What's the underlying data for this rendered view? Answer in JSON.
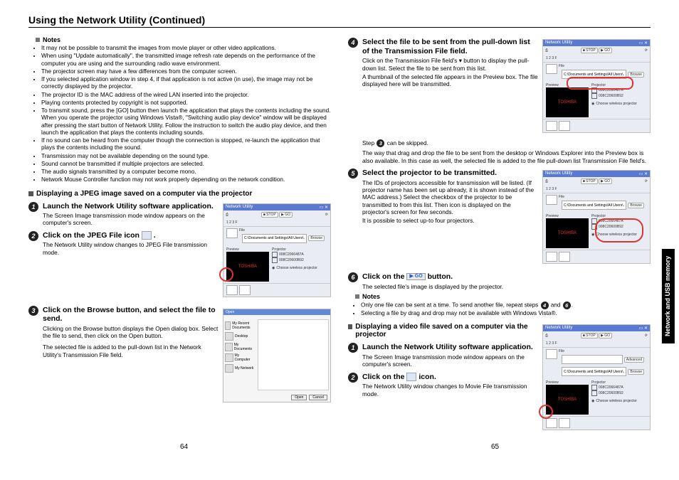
{
  "title": "Using the Network Utility (Continued)",
  "sideTab": "Network and USB memory",
  "pageLeft": "64",
  "pageRight": "65",
  "notesLabel": "Notes",
  "notes1": [
    "It may not be possible to transmit the images from movie player or other video applications.",
    "When using \"Update automatically\", the transmitted image refresh rate depends on the performance of the computer you are using and the surrounding radio wave environment.",
    "The projector screen may have a few differences from the computer screen.",
    "If you selected application window in step 4, if that application is not active (in use), the image may not be correctly displayed by the projector.",
    "The projector ID is the MAC address of the wired LAN inserted into the projector.",
    "Playing contents protected by copyright is not supported.",
    "To transmit sound, press the [GO] button then launch the application that plays the contents including the sound. When you operate the projector using Windows Vista®, \"Switching audio play device\" window will be displayed after pressing the start button of Network Utility. Follow the instruction to switch the audio play device, and then launch the application that plays the contents including sounds.",
    "If no sound can be heard from the computer though the connection is stopped, re-launch the application that plays the contents including the sound.",
    "Transmission may not be available depending on the sound type.",
    "Sound cannot be transmitted if multiple projectors are selected.",
    "The audio signals transmitted by a computer become mono.",
    "Network Mouse Controller function may not work properly depending on the network condition."
  ],
  "sectionJpeg": "Displaying a JPEG image saved on a computer via the projector",
  "step1": {
    "head": "Launch the Network Utility software application.",
    "text": "The Screen Image transmission mode window appears on the computer's screen."
  },
  "step2": {
    "head": "Click on the JPEG File icon",
    "text": "The Network Utility window changes to JPEG File transmission mode."
  },
  "step3": {
    "head": "Click on the Browse button, and select the file to send.",
    "text1": "Clicking on the Browse button displays the Open dialog box. Select the file to send, then click on the Open button.",
    "text2": "The selected file is added to the pull-down list in the Network Utility's Transmission File field."
  },
  "step4": {
    "head": "Select the file to be sent from the pull-down list of the Transmission File field.",
    "t1": "Click on the Transmission File field's  ▾  button to display the pull-down list. Select the file to be sent from this list.",
    "t2": "A thumbnail of the selected file appears in the Preview box. The file displayed here will be transmitted.",
    "t3": "Step 3 can be skipped.",
    "t4": "The way that drag and drop the file to be sent from the desktop or Windows Explorer into the Preview box is also available. In this case as well, the selected file is added to the file pull-down list Transmission File field's."
  },
  "step5": {
    "head": "Select the projector to be transmitted.",
    "t1": "The IDs of projectors accessible for transmission will be listed. (If projector name has been set up already, it is shown instead of the MAC address.) Select the checkbox of the projector to be transmitted to from this list. Then icon  is displayed on the projector's screen for few seconds.",
    "t2": "It is possible to select up-to four projectors."
  },
  "step6": {
    "headPre": "Click on the ",
    "headPost": " button.",
    "t1": "The selected file's image is displayed by the projector."
  },
  "notes2": [
    "Only one file can be sent at a time. To send another file, repeat steps 4 and 6.",
    "Selecting a file by drag and drop may not be available with Windows Vista®."
  ],
  "sectionVideo": "Displaying a video file saved on a computer via the projector",
  "vstep1": {
    "head": "Launch the Network Utility software application.",
    "text": "The Screen Image transmission mode window appears on the computer's screen."
  },
  "vstep2": {
    "headPre": "Click on the ",
    "headPost": " icon.",
    "text": "The Network Utility window changes to Movie File transmission mode."
  },
  "thumbTitle": "Network Utility",
  "thumbStop": "■ STOP",
  "thumbGo": "▶ GO",
  "thumbFileLabel": "File",
  "thumbPath": "C:\\Documents and Settings\\All Users\\..",
  "thumbBrowse": "Browse",
  "thumbPreview": "Preview",
  "thumbProjector": "Projector",
  "thumbMac1": "008C2066487A",
  "thumbMac2": "008C20600B92",
  "thumbChoose": "Choose wireless projector",
  "openTitle": "Open",
  "openSide": [
    "My Recent Documents",
    "Desktop",
    "My Documents",
    "My Computer",
    "My Network"
  ],
  "openBtnOpen": "Open",
  "openBtnCancel": "Cancel",
  "goLabel": "▶ GO",
  "movieIconName": "movie-file-icon"
}
